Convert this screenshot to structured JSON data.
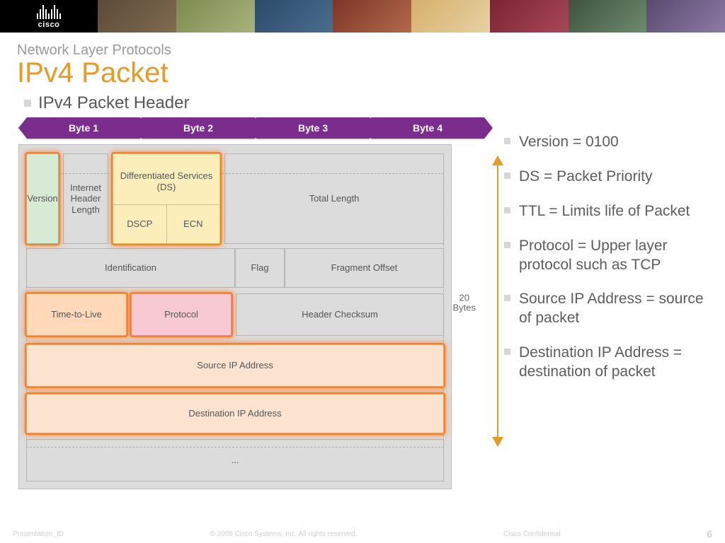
{
  "brand": "cisco",
  "supertitle": "Network Layer Protocols",
  "title": "IPv4 Packet",
  "subtitle": "IPv4 Packet Header",
  "bytes": [
    "Byte 1",
    "Byte 2",
    "Byte 3",
    "Byte 4"
  ],
  "vert_label_top": "20",
  "vert_label_bot": "Bytes",
  "fields": {
    "version": "Version",
    "ihl": "Internet Header Length",
    "ds": "Differentiated Services (DS)",
    "dscp": "DSCP",
    "ecn": "ECN",
    "total_length": "Total Length",
    "identification": "Identification",
    "flag": "Flag",
    "fragment_offset": "Fragment Offset",
    "ttl": "Time-to-Live",
    "protocol": "Protocol",
    "checksum": "Header Checksum",
    "src": "Source IP Address",
    "dst": "Destination IP Address",
    "dots": "..."
  },
  "facts": [
    "Version = 0100",
    "DS = Packet Priority",
    "TTL = Limits life of Packet",
    "Protocol = Upper layer protocol such as TCP",
    "Source IP Address = source of packet",
    "Destination IP Address = destination of packet"
  ],
  "footer": {
    "left": "Presentation_ID",
    "mid": "© 2008 Cisco Systems, Inc. All rights reserved.",
    "right": "Cisco Confidential",
    "page": "6"
  }
}
